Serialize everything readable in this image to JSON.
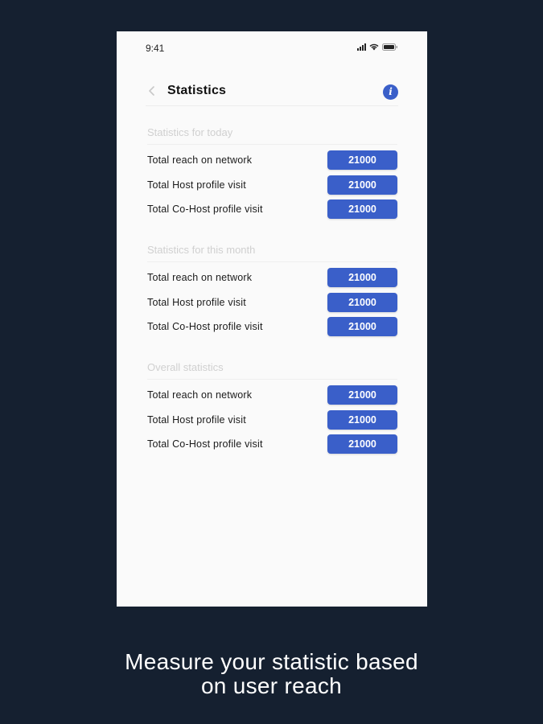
{
  "status_bar": {
    "time": "9:41"
  },
  "header": {
    "title": "Statistics",
    "back_icon": "chevron-left-icon",
    "info_icon": "info-icon",
    "info_glyph": "i"
  },
  "colors": {
    "background": "#152030",
    "accent": "#3a5fc9",
    "screen": "#fafafa"
  },
  "sections": [
    {
      "title": "Statistics for today",
      "rows": [
        {
          "label": "Total reach on network",
          "value": "21000"
        },
        {
          "label": "Total Host profile visit",
          "value": "21000"
        },
        {
          "label": "Total Co-Host profile visit",
          "value": "21000"
        }
      ]
    },
    {
      "title": "Statistics for this month",
      "rows": [
        {
          "label": "Total reach on network",
          "value": "21000"
        },
        {
          "label": "Total Host profile visit",
          "value": "21000"
        },
        {
          "label": "Total Co-Host profile visit",
          "value": "21000"
        }
      ]
    },
    {
      "title": "Overall statistics",
      "rows": [
        {
          "label": "Total reach on network",
          "value": "21000"
        },
        {
          "label": "Total Host profile visit",
          "value": "21000"
        },
        {
          "label": "Total Co-Host profile visit",
          "value": "21000"
        }
      ]
    }
  ],
  "caption": {
    "line1": "Measure your statistic based",
    "line2": "on user reach"
  }
}
